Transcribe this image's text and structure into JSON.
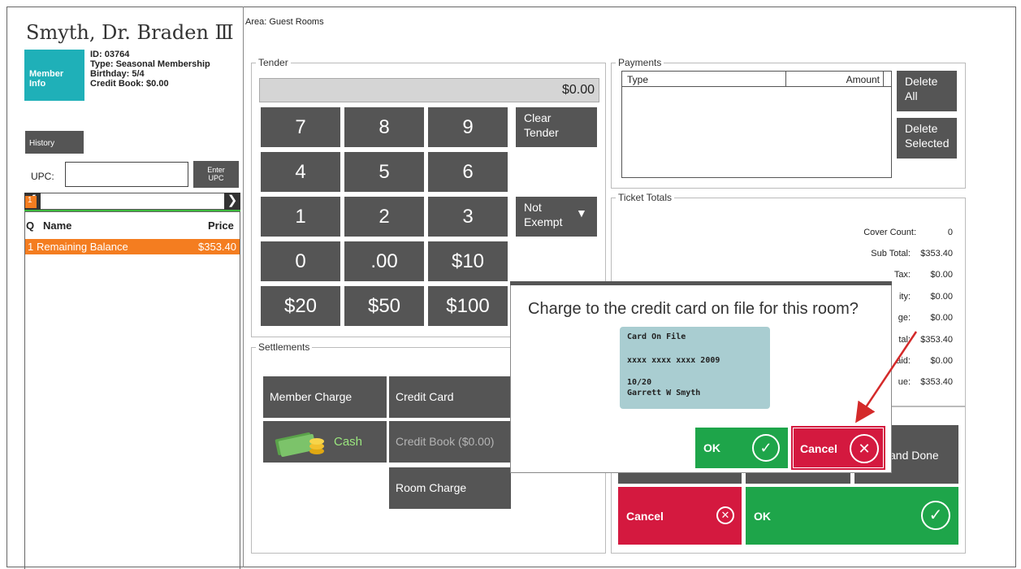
{
  "member": {
    "name": "Smyth, Dr. Braden Ⅲ",
    "tile_label_1": "Member",
    "tile_label_2": "Info",
    "id_line": "ID: 03764",
    "type_line": "Type: Seasonal Membership",
    "birthday_line": "Birthday: 5/4",
    "credit_line": "Credit Book: $0.00"
  },
  "left": {
    "history": "History",
    "upc_label": "UPC:",
    "upc_value": "",
    "enter_upc_1": "Enter",
    "enter_upc_2": "UPC",
    "page": "1",
    "headers": {
      "q": "Q",
      "name": "Name",
      "price": "Price"
    },
    "rows": [
      {
        "q": "1",
        "name": "Remaining Balance",
        "price": "$353.40"
      }
    ]
  },
  "area": "Area: Guest Rooms",
  "tender": {
    "legend": "Tender",
    "display": "$0.00",
    "keys": [
      "7",
      "8",
      "9",
      "4",
      "5",
      "6",
      "1",
      "2",
      "3",
      "0",
      ".00",
      "$10",
      "$20",
      "$50",
      "$100"
    ],
    "clear_1": "Clear",
    "clear_2": "Tender",
    "exempt_1": "Not",
    "exempt_2": "Exempt"
  },
  "payments": {
    "legend": "Payments",
    "col_type": "Type",
    "col_amount": "Amount",
    "delete_all_1": "Delete",
    "delete_all_2": "All",
    "delete_sel_1": "Delete",
    "delete_sel_2": "Selected"
  },
  "totals": {
    "legend": "Ticket Totals",
    "rows": [
      {
        "label": "Cover Count:",
        "value": "0"
      },
      {
        "label": "Sub Total:",
        "value": "$353.40"
      },
      {
        "label": "Tax:",
        "value": "$0.00"
      },
      {
        "label": "ity:",
        "value": "$0.00"
      },
      {
        "label": "ge:",
        "value": "$0.00"
      },
      {
        "label": "tal:",
        "value": "$353.40"
      },
      {
        "label": "aid:",
        "value": "$0.00"
      },
      {
        "label": "ue:",
        "value": "$353.40"
      }
    ]
  },
  "settlements": {
    "legend": "Settlements",
    "member_charge": "Member Charge",
    "credit_card": "Credit Card",
    "cash": "Cash",
    "credit_book": "Credit Book ($0.00)",
    "room_charge": "Room Charge"
  },
  "bottom": {
    "and_done": "and Done",
    "cancel": "Cancel",
    "ok": "OK"
  },
  "modal": {
    "question": "Charge to the credit card on file for this room?",
    "card_title": "Card On File",
    "card_number": "xxxx xxxx xxxx 2009",
    "card_exp": "10/20",
    "card_holder": "Garrett W Smyth",
    "ok": "OK",
    "cancel": "Cancel"
  },
  "colors": {
    "accent_orange": "#f47d20",
    "tile_teal": "#1fb0b8",
    "ok_green": "#1ea54a",
    "cancel_red": "#d4193f",
    "button_gray": "#555555"
  }
}
